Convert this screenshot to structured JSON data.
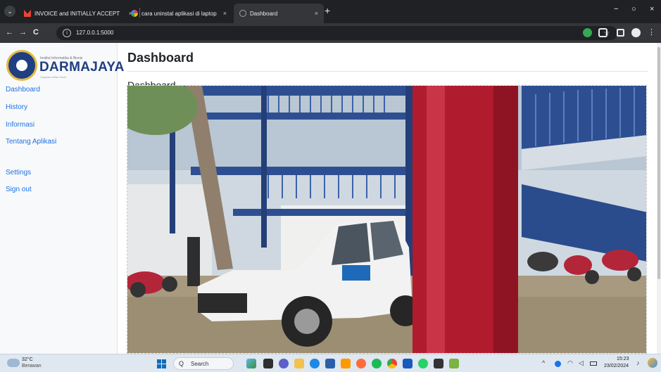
{
  "browser": {
    "tabs": [
      {
        "title": "INVOICE and INITIALLY ACCEPT",
        "favicon": "gmail-icon",
        "color": "#ea4335"
      },
      {
        "title": "cara uninstal aplikasi di laptop",
        "favicon": "google-icon",
        "color": "#4285f4"
      },
      {
        "title": "Dashboard",
        "favicon": "page-icon",
        "color": "#9aa0a6"
      }
    ],
    "url": "127.0.0.1:5000",
    "close_glyph": "×",
    "new_tab_glyph": "+",
    "menu_glyph": "⌄",
    "back_glyph": "←",
    "forward_glyph": "→",
    "reload_glyph": "C",
    "info_glyph": "i",
    "star_glyph": "☆",
    "window_controls": {
      "minimize": "−",
      "restore": "○",
      "close": "×"
    }
  },
  "app": {
    "logo": {
      "small": "Institut Informatika & Bisnis",
      "name": "DARMAJAYA",
      "tagline": "Yayasan Alfian Husin"
    },
    "nav": [
      {
        "label": "Dashboard"
      },
      {
        "label": "History"
      },
      {
        "label": "Informasi"
      },
      {
        "label": "Tentang Aplikasi"
      },
      {
        "label": "Settings"
      },
      {
        "label": "Sign out"
      }
    ],
    "page_title": "Dashboard",
    "subtitle": "Dashboard",
    "feed": {
      "description": "live camera view",
      "colors": {
        "sky": "#d5e0ea",
        "structure": "#2d4f92",
        "ground": "#a89a80",
        "pillar": "#b01b2e",
        "car": "#f2f2f2"
      }
    }
  },
  "taskbar": {
    "weather": {
      "temp": "32°C",
      "condition": "Berawan"
    },
    "search_label": "Search",
    "search_glyph": "Q",
    "tray_chevron": "^",
    "clock": {
      "time": "15:23",
      "date": "23/02/2024"
    }
  }
}
